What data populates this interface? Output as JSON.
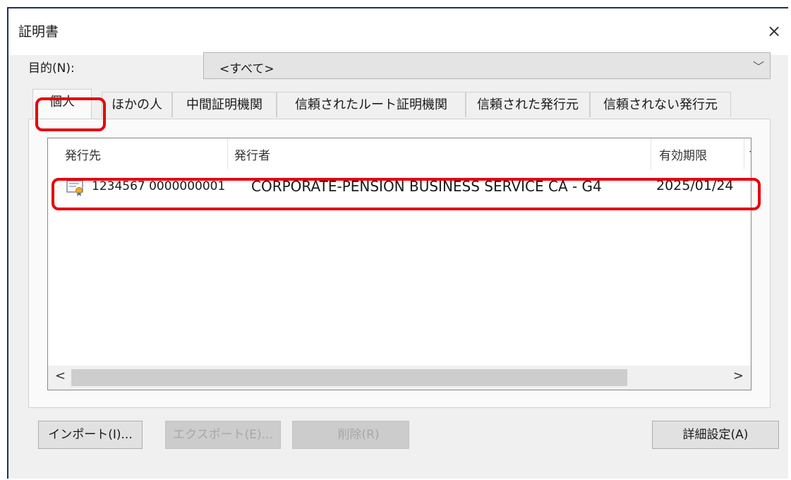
{
  "window": {
    "title": "証明書",
    "close_icon": "×"
  },
  "purpose": {
    "label": "目的(N):",
    "value": "<すべて>",
    "chevron": "﹀"
  },
  "tabs": [
    {
      "label": "個人"
    },
    {
      "label": "ほかの人"
    },
    {
      "label": "中間証明機関"
    },
    {
      "label": "信頼されたルート証明機関"
    },
    {
      "label": "信頼された発行元"
    },
    {
      "label": "信頼されない発行元"
    }
  ],
  "list": {
    "columns": [
      "発行先",
      "発行者",
      "有効期限",
      "フ"
    ],
    "rows": [
      {
        "issued_to": "1234567 0000000001",
        "issued_by": "CORPORATE-PENSION BUSINESS SERVICE CA - G4",
        "expires": "2025/01/24"
      }
    ],
    "scroll_left": "<",
    "scroll_right": ">"
  },
  "buttons": {
    "import": "インポート(I)...",
    "export": "エクスポート(E)...",
    "delete": "削除(R)",
    "advanced": "詳細設定(A)"
  },
  "note_mark": "※",
  "colors": {
    "highlight": "#e8000d",
    "frame": "#1f2d5a"
  },
  "icons": {
    "certificate": "certificate-icon"
  }
}
